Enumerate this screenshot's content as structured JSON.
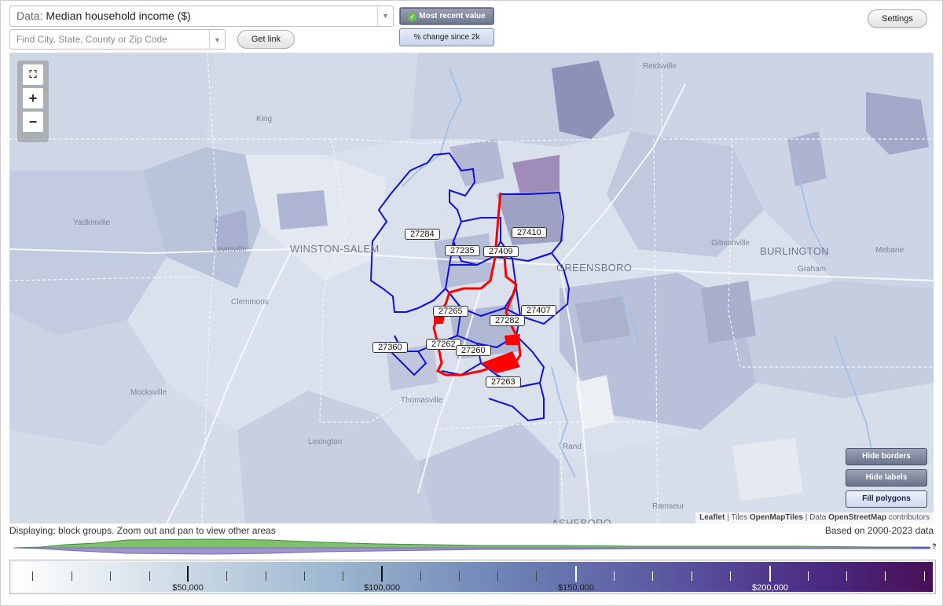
{
  "toolbar": {
    "data_prefix": "Data:",
    "data_value": "Median household income ($)",
    "search_placeholder": "Find City, State, County or Zip Code",
    "get_link_label": "Get link",
    "mode_active_label": "Most recent value",
    "mode_inactive_label": "% change since 2k",
    "settings_label": "Settings"
  },
  "map": {
    "zoom_fullscreen": "⛶",
    "zoom_in": "+",
    "zoom_out": "−",
    "places": {
      "reidsville": "Reidsville",
      "king": "King",
      "yadkinville": "Yadkinville",
      "lewisville": "Lewisville",
      "winston_salem": "WINSTON-SALEM",
      "clemmons": "Clemmons",
      "mocksville": "Mocksville",
      "thomasville": "Thomasville",
      "lexington": "Lexington",
      "greensboro": "GREENSBORO",
      "gibsonville": "Gibsonville",
      "burlington": "BURLINGTON",
      "graham": "Graham",
      "mebane": "Mebane",
      "rand": "Rand",
      "ramseur": "Ramseur",
      "asheboro": "ASHEBORO"
    },
    "zips": {
      "z27284": "27284",
      "z27410": "27410",
      "z27235": "27235",
      "z27409": "27409",
      "z27265": "27265",
      "z27407": "27407",
      "z27282": "27282",
      "z27360": "27360",
      "z27262": "27262",
      "z27260": "27260",
      "z27263": "27263"
    },
    "buttons": {
      "hide_borders": "Hide borders",
      "hide_labels": "Hide labels",
      "fill_polygons": "Fill polygons"
    },
    "attribution": {
      "leaflet": "Leaflet",
      "sep1": " | Tiles ",
      "tiles": "OpenMapTiles",
      "sep2": " | Data ",
      "data": "OpenStreetMap",
      "tail": " contributors"
    },
    "colors": {
      "zip_border": "#1010e0",
      "highlight_border": "#ff0000"
    }
  },
  "status": {
    "displaying": "Displaying: block groups. Zoom out and pan to view other areas",
    "based_on": "Based on 2000-2023 data"
  },
  "legend": {
    "help": "?",
    "labels": {
      "l50k": "$50,000",
      "l100k": "$100,000",
      "l150k": "$150,000",
      "l200k": "$200,000"
    },
    "color_low": "#ffffff",
    "color_high": "#4a0f55"
  }
}
